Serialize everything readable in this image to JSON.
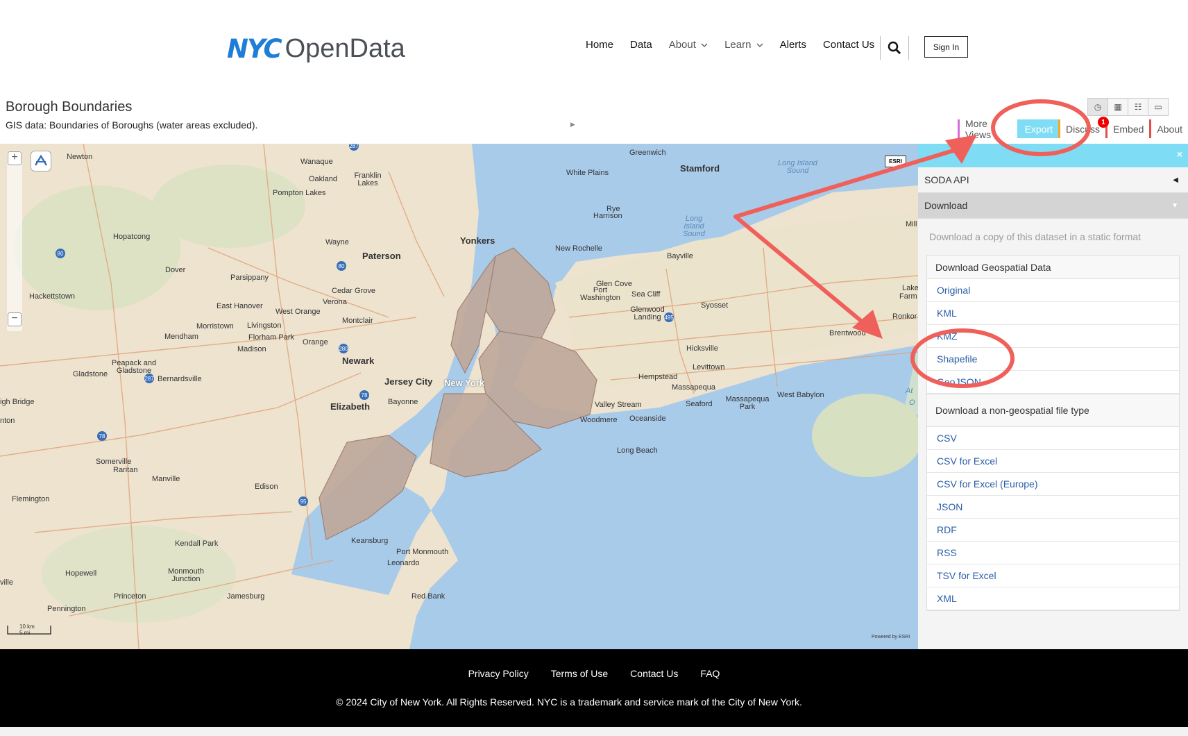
{
  "logo": {
    "nyc": "NYC",
    "opendata": "OpenData"
  },
  "nav": {
    "items": [
      {
        "label": "Home"
      },
      {
        "label": "Data"
      },
      {
        "label": "About",
        "dropdown": true
      },
      {
        "label": "Learn",
        "dropdown": true
      },
      {
        "label": "Alerts"
      },
      {
        "label": "Contact Us"
      }
    ],
    "search_icon": "search-icon",
    "signin": "Sign In"
  },
  "dataset": {
    "title": "Borough Boundaries",
    "description": "GIS data: Boundaries of Boroughs (water areas excluded)."
  },
  "view_icons": [
    "clock-icon",
    "grid-icon",
    "list-icon",
    "page-icon"
  ],
  "tabs": {
    "items": [
      "More Views",
      "Export",
      "Discuss",
      "Embed",
      "About"
    ],
    "colors": [
      "#d86bd8",
      "#7fdcf5",
      "#f5a623",
      "#e04d4d",
      "#e04d4d"
    ],
    "active": "Export",
    "badge": "1"
  },
  "map": {
    "labels": {
      "newton": "Newton",
      "wanaque": "Wanaque",
      "oakland": "Oakland",
      "franklin_lakes": "Franklin Lakes",
      "pompton": "Pompton Lakes",
      "greenwich": "Greenwich",
      "white_plains": "White Plains",
      "stamford": "Stamford",
      "lis1": "Long Island Sound",
      "lis2": "Long Island Sound",
      "rye": "Rye",
      "harrison": "Harrison",
      "hopatcong": "Hopatcong",
      "wayne": "Wayne",
      "yonkers": "Yonkers",
      "paterson": "Paterson",
      "new_rochelle": "New Rochelle",
      "bayville": "Bayville",
      "dover": "Dover",
      "parsippany": "Parsippany",
      "glen_cove": "Glen Cove",
      "cedar_grove": "Cedar Grove",
      "verona": "Verona",
      "port_washington": "Port Washington",
      "sea_cliff": "Sea Cliff",
      "hackettstown": "Hackettstown",
      "east_hanover": "East Hanover",
      "glenwood": "Glenwood Landing",
      "syosset": "Syosset",
      "west_orange": "West Orange",
      "montclair": "Montclair",
      "morristown": "Morristown",
      "livingston": "Livingston",
      "mendham": "Mendham",
      "florham": "Florham Park",
      "orange": "Orange",
      "brentwood": "Brentwood",
      "hicksville": "Hicksville",
      "madison": "Madison",
      "newark": "Newark",
      "levittown": "Levittown",
      "peapack": "Peapack and Gladstone",
      "gladstone": "Gladstone",
      "bernardsville": "Bernardsville",
      "jersey_city": "Jersey City",
      "new_york": "New York",
      "hempstead": "Hempstead",
      "massapequa": "Massapequa",
      "west_babylon": "West Babylon",
      "high_bridge": "igh Bridge",
      "elizabeth": "Elizabeth",
      "bayonne": "Bayonne",
      "valley_stream": "Valley Stream",
      "seaford": "Seaford",
      "massapequa_park": "Massapequa Park",
      "woodmere": "Woodmere",
      "oceanside": "Oceanside",
      "nton": "nton",
      "somerville": "Somerville",
      "raritan": "Raritan",
      "manville": "Manville",
      "long_beach": "Long Beach",
      "flemington": "Flemington",
      "edison": "Edison",
      "kendall_park": "Kendall Park",
      "keansburg": "Keansburg",
      "port_monmouth": "Port Monmouth",
      "leonardo": "Leonardo",
      "hopewell": "Hopewell",
      "monmouth_junction": "Monmouth Junction",
      "ville": "ville",
      "princeton": "Princeton",
      "jamesburg": "Jamesburg",
      "red_bank": "Red Bank",
      "pennington": "Pennington",
      "mill": "Mill",
      "lake": "Lake",
      "farm": "Farm",
      "ronko": "Ronkor",
      "at": "At",
      "o": "O"
    },
    "esri": "ESRI",
    "powered": "Powered by ESRI",
    "scale_km": "10 km",
    "scale_mi": "5 mi",
    "zoom_in": "+",
    "zoom_out": "−"
  },
  "panel": {
    "close": "×",
    "soda": "SODA API",
    "download": "Download",
    "desc": "Download a copy of this dataset in a static format",
    "geo_head": "Download Geospatial Data",
    "geo_items": [
      "Original",
      "KML",
      "KMZ",
      "Shapefile",
      "GeoJSON"
    ],
    "nongeo_head": "Download a non-geospatial file type",
    "nongeo_items": [
      "CSV",
      "CSV for Excel",
      "CSV for Excel (Europe)",
      "JSON",
      "RDF",
      "RSS",
      "TSV for Excel",
      "XML"
    ]
  },
  "footer": {
    "links": [
      "Privacy Policy",
      "Terms of Use",
      "Contact Us",
      "FAQ"
    ],
    "copyright": "© 2024 City of New York. All Rights Reserved. NYC is a trademark and service mark of the City of New York."
  },
  "annotation_color": "#f0605a"
}
